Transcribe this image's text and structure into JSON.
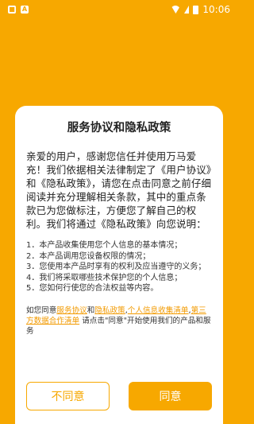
{
  "status_bar": {
    "time": "10:06",
    "left_icons": [
      "app-notification-icon",
      "a-notification-icon"
    ],
    "right_icons": [
      "signal-icon",
      "wifi-icon",
      "battery-icon"
    ]
  },
  "dialog": {
    "title": "服务协议和隐私政策",
    "intro": "亲爱的用户，感谢您信任并使用万马爱充！我们依据相关法律制定了《用户协议》和《隐私政策》，请您在点击同意之前仔细阅读并充分理解相关条款，其中的重点条款已为您做标注，方便您了解自己的权利。我们将通过《隐私政策》向您说明：",
    "items": [
      "1．本产品收集使用您个人信息的基本情况；",
      "2．本产品调用您设备权限的情况；",
      "3．您使用本产品时享有的权利及应当遵守的义务；",
      "4．我们将采取哪些技术保护您的个人信息；",
      "5．您如何行使您的合法权益等内容。"
    ],
    "agree_prefix": "如您同意",
    "link_service": "服务协议",
    "and": "和",
    "link_privacy": "隐私政策",
    "comma1": ",",
    "link_personal_info": "个人信息收集清单",
    "comma2": ",",
    "link_third_party": "第三方数据合作清单",
    "agree_suffix": "  请点击\"同意\"开始使用我们的产品和服务",
    "disagree_label": "不同意",
    "agree_label": "同意"
  },
  "colors": {
    "accent": "#F7A800",
    "link": "#F29A00"
  }
}
